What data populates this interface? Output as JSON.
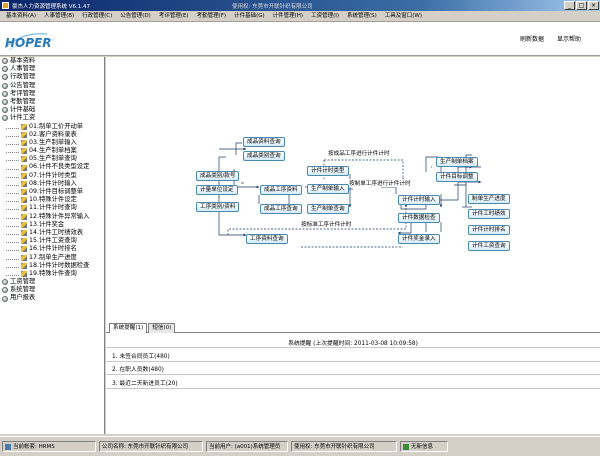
{
  "window": {
    "title": "豪杰人力资源管理系统 V6.1.47",
    "user_text": "使用权: 东莞市开联针织有限公司",
    "controls": [
      "_",
      "□",
      "×"
    ]
  },
  "menu": [
    "基本资料(A)",
    "人事管理(B)",
    "行政管理(C)",
    "公告管理(D)",
    "考评管理(E)",
    "考勤管理(F)",
    "计件基础(G)",
    "计件管理(H)",
    "工资管理(I)",
    "系统管理(S)",
    "工具及窗口(W)"
  ],
  "logo": "HOPER",
  "toolbar": {
    "refresh": "刷新数据",
    "help": "显示帮助"
  },
  "tree": [
    {
      "label": "基本资料",
      "level": 0
    },
    {
      "label": "人事管理",
      "level": 0
    },
    {
      "label": "行政管理",
      "level": 0
    },
    {
      "label": "公告管理",
      "level": 0
    },
    {
      "label": "考评管理",
      "level": 0
    },
    {
      "label": "考勤管理",
      "level": 0
    },
    {
      "label": "计件基础",
      "level": 0
    },
    {
      "label": "计件工资",
      "level": 0
    },
    {
      "label": "01.制单工价开动单",
      "level": 1
    },
    {
      "label": "02.客户资料录表",
      "level": 1
    },
    {
      "label": "03.生产制单输入",
      "level": 1
    },
    {
      "label": "04.生产制单档案",
      "level": 1
    },
    {
      "label": "05.生产制单查询",
      "level": 1
    },
    {
      "label": "06.计件不良类型设定",
      "level": 1
    },
    {
      "label": "07.计件计时类型",
      "level": 1
    },
    {
      "label": "08.计件计时输入",
      "level": 1
    },
    {
      "label": "09.计件目标调整单",
      "level": 1
    },
    {
      "label": "10.特殊计件设定",
      "level": 1
    },
    {
      "label": "11.计件计时查询",
      "level": 1
    },
    {
      "label": "12.特殊计件异常输入",
      "level": 1
    },
    {
      "label": "13.计件奖金",
      "level": 1
    },
    {
      "label": "14.计件工时绩效表",
      "level": 1
    },
    {
      "label": "15.计件工资查询",
      "level": 1
    },
    {
      "label": "16.计件计时排名",
      "level": 1
    },
    {
      "label": "17.制单生产进度",
      "level": 1
    },
    {
      "label": "18.计件计时数据检查",
      "level": 1
    },
    {
      "label": "19.特殊计件查询",
      "level": 1
    },
    {
      "label": "工资管理",
      "level": 0
    },
    {
      "label": "系统管理",
      "level": 0
    },
    {
      "label": "用户报表",
      "level": 0
    }
  ],
  "flow": {
    "nodes": {
      "product_info": "成品资料查询",
      "product_type": "成品类别查询",
      "product_class": "成品类别/款号",
      "unit_setting": "计量单位设定",
      "process_type": "工序类别/资料",
      "product_process": "成品工序资料",
      "process_query": "成品工序查询",
      "process_info_query": "工序资料查询",
      "piece_type": "计件计时类型",
      "order_input": "生产制单输入",
      "order_query": "生产制单查询",
      "piece_input": "计件计时输入",
      "piece_check": "计件数据检查",
      "bonus_input": "计件奖金录入",
      "order_archive": "生产制单档案",
      "piece_goal": "计件目标调整",
      "production_progress": "制单生产进度",
      "piece_performance": "计件工时绩效",
      "piece_ranking": "计件计时排名",
      "wage_query": "计件工资查询"
    },
    "labels": {
      "by_product": "按成品工序进行计件计时",
      "by_order": "按制单工序进行计件计时",
      "by_standard": "按标准工序计件计时"
    }
  },
  "tabs": [
    "系统提醒(1)",
    "短信(0)"
  ],
  "reminder": {
    "header": "系统提醒 (上次提醒时间: 2011-03-08 10:09:58)",
    "items": [
      "1. 未签合同员工(480)",
      "2. 在职人员数(480)",
      "3. 最近二天新进员工(20)"
    ]
  },
  "status": {
    "account": "当前帐套: HRMS",
    "company": "公司名称: 东莞市开联针织有限公司",
    "current_user": "当前用户: (a001)系统管理员",
    "license": "使用权: 东莞市开联针织有限公司",
    "message": "无新信息"
  },
  "colors": {
    "title_bar": "#0a246a",
    "node_border": "#4a8ab0",
    "logo": "#2a7ab8"
  }
}
